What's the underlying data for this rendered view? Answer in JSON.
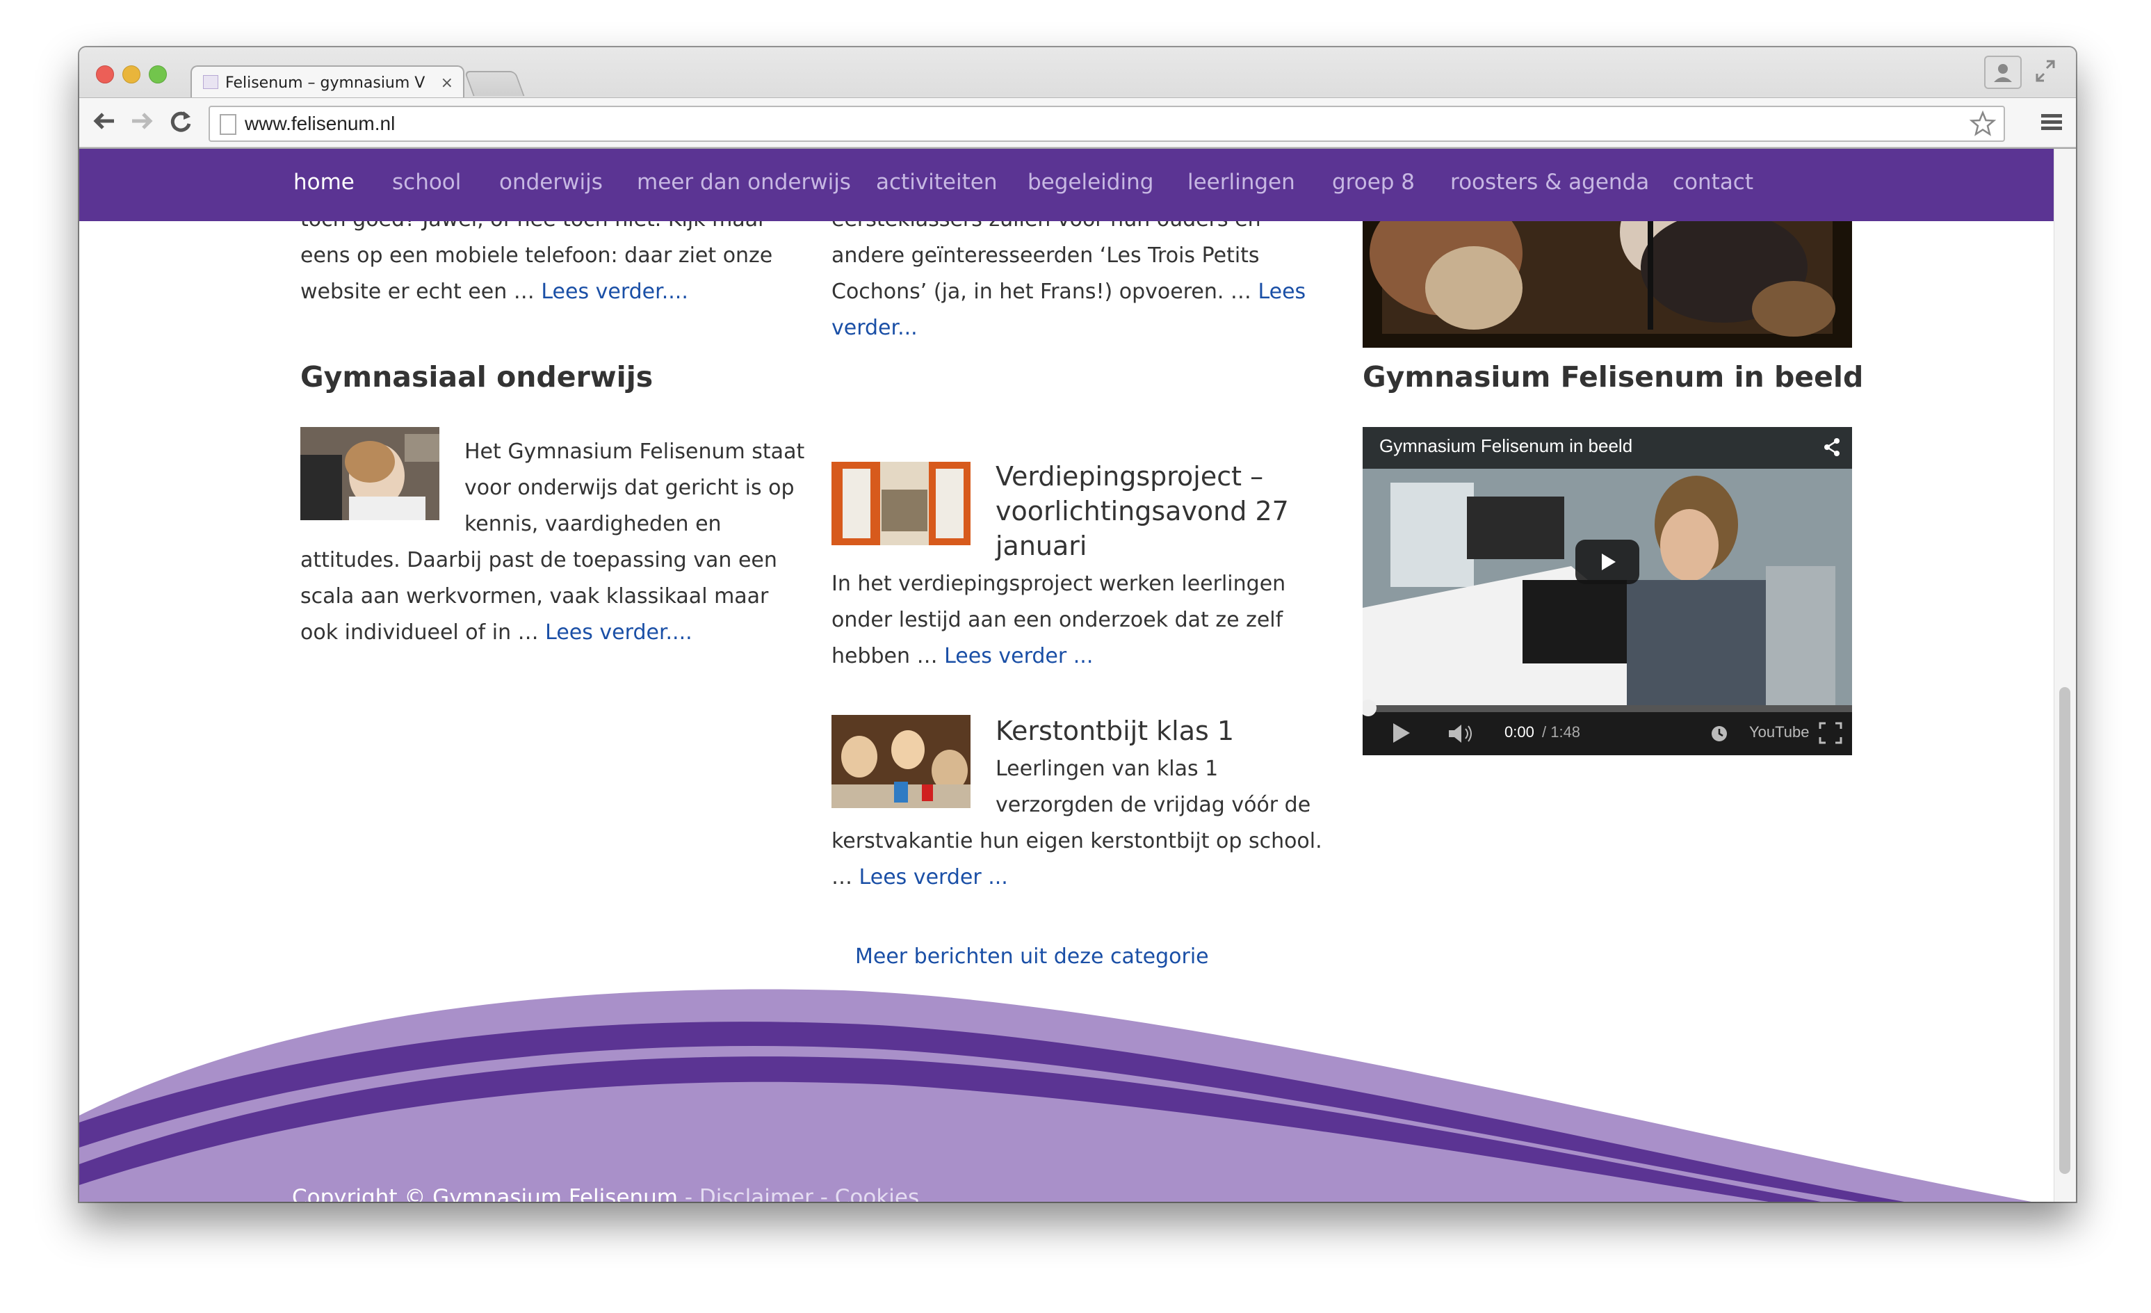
{
  "browser": {
    "tab_title": "Felisenum – gymnasium V",
    "tab_close": "×",
    "url": "www.felisenum.nl"
  },
  "nav": {
    "items": [
      {
        "label": "home",
        "active": true
      },
      {
        "label": "school"
      },
      {
        "label": "onderwijs"
      },
      {
        "label": "meer dan onderwijs"
      },
      {
        "label": "activiteiten"
      },
      {
        "label": "begeleiding"
      },
      {
        "label": "leerlingen"
      },
      {
        "label": "groep 8"
      },
      {
        "label": "roosters & agenda"
      },
      {
        "label": "contact"
      }
    ],
    "bg_color": "#5b3493"
  },
  "col1_top": {
    "line1": "toch goed? Jawel, of nee toch niet. Kijk maar",
    "line2": "eens op een mobiele telefoon: daar ziet onze",
    "line3": "website er echt een … ",
    "link": "Lees verder...."
  },
  "col2_top": {
    "line1": "eersteklassers zullen voor hun ouders en",
    "line2": "andere geïnteresseerden ‘Les Trois Petits",
    "line3": "Cochons’ (ja, in het Frans!) opvoeren.  … ",
    "link_a": "Lees",
    "link_b": "verder..."
  },
  "gymnasiaal": {
    "heading": "Gymnasiaal onderwijs",
    "lines": [
      "Het Gymnasium Felisenum staat",
      "voor onderwijs dat gericht is op",
      "kennis, vaardigheden en",
      "attitudes. Daarbij past de toepassing van een",
      "scala aan werkvormen, vaak klassikaal maar",
      "ook individueel of in … "
    ],
    "link": "Lees verder...."
  },
  "verdieping": {
    "title_lines": [
      "Verdiepingsproject –",
      "voorlichtingsavond 27",
      "januari"
    ],
    "lines": [
      "In het verdiepingsproject werken leerlingen",
      "onder lestijd aan een onderzoek dat ze zelf",
      "hebben … "
    ],
    "link": "Lees verder ..."
  },
  "kerst": {
    "title": "Kerstontbijt klas 1",
    "lines": [
      "Leerlingen van klas 1",
      "verzorgden de vrijdag vóór de",
      "kerstvakantie hun eigen kerstontbijt op school.",
      "… "
    ],
    "link": "Lees verder ..."
  },
  "more_link": "Meer berichten uit deze categorie",
  "beeld": {
    "heading": "Gymnasium Felisenum in beeld",
    "video_title": "Gymnasium Felisenum in beeld",
    "time_current": "0:00",
    "time_total": "/ 1:48",
    "youtube_label": "YouTube"
  },
  "footer": {
    "copyright": "Copyright © Gymnasium Felisenum",
    "sep": " - ",
    "disclaimer": "Disclaimer",
    "cookies": "Cookies",
    "wave_light": "#a990c9",
    "wave_dark": "#5b3493"
  }
}
